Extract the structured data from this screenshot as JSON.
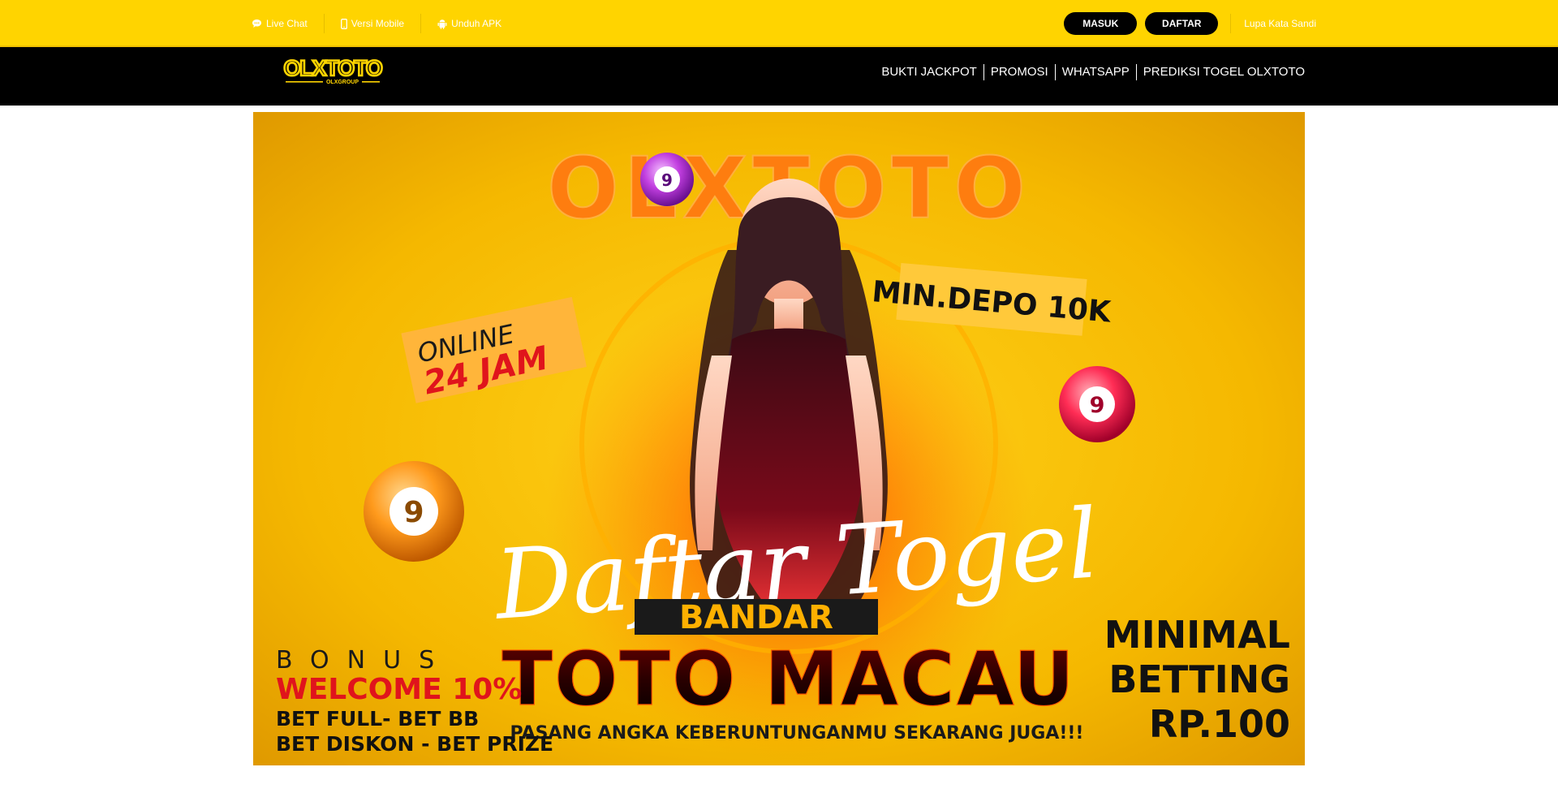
{
  "topbar": {
    "links": [
      {
        "label": "Live Chat",
        "icon": "chat-bubble-icon"
      },
      {
        "label": "Versi Mobile",
        "icon": "mobile-phone-icon"
      },
      {
        "label": "Unduh APK",
        "icon": "android-icon"
      }
    ],
    "login_label": "MASUK",
    "register_label": "DAFTAR",
    "forgot_label": "Lupa Kata Sandi"
  },
  "header": {
    "logo_text": "OLXTOTO",
    "logo_subtext": "OLXGROUP",
    "nav": [
      "BUKTI JACKPOT",
      "PROMOSI",
      "WHATSAPP",
      "PREDIKSI TOGEL OLXTOTO"
    ]
  },
  "banner": {
    "brand": "OLXTOTO",
    "online_line1": "ONLINE",
    "online_line2": "24 JAM",
    "min_depo": "MIN.DEPO 10K",
    "headline": "Daftar Togel",
    "bandar": "BANDAR",
    "product": "TOTO MACAU",
    "tagline": "PASANG ANGKA KEBERUNTUNGANMU SEKARANG JUGA!!!",
    "bonus_title": "BONUS",
    "bonus_welcome": "WELCOME 10%",
    "bonus_line1": "BET FULL- BET BB",
    "bonus_line2": "BET DISKON - BET PRIZE",
    "minimal_line1": "MINIMAL",
    "minimal_line2": "BETTING",
    "minimal_line3": "RP.100",
    "ball_number": "9"
  },
  "colors": {
    "topbar": "#ffd400",
    "navbar": "#000000",
    "banner_bg": "#f2b400",
    "brand_orange": "#ff6a00",
    "accent_red": "#e0141c"
  }
}
